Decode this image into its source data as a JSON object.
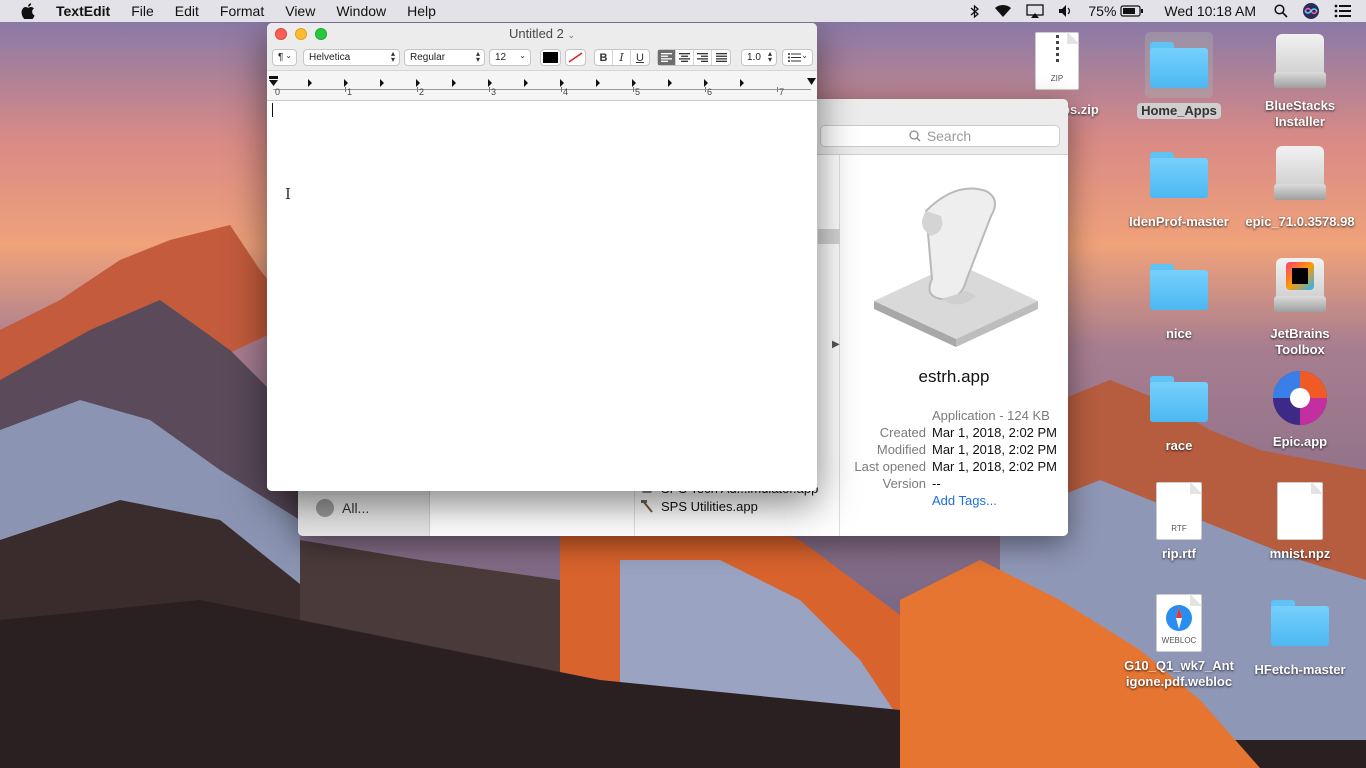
{
  "menubar": {
    "app_name": "TextEdit",
    "menus": [
      "File",
      "Edit",
      "Format",
      "View",
      "Window",
      "Help"
    ],
    "battery": "75%",
    "clock": "Wed 10:18 AM",
    "icons": [
      "apple-icon",
      "bluetooth-icon",
      "wifi-icon",
      "airplay-icon",
      "volume-icon",
      "battery-icon",
      "spotlight-icon",
      "siri-icon",
      "notification-center-icon"
    ]
  },
  "textedit": {
    "title": "Untitled 2",
    "paragraph_style": "¶",
    "font_family": "Helvetica",
    "font_style": "Regular",
    "font_size": "12",
    "bold": "B",
    "italic": "I",
    "underline": "U",
    "line_spacing": "1.0",
    "ruler_numbers": [
      "0",
      "1",
      "2",
      "3",
      "4",
      "5",
      "6",
      "7"
    ],
    "text_color": "#000000"
  },
  "finder": {
    "search_placeholder": "Search",
    "sidebar_all": "All...",
    "files": [
      "SPS Tech Ad...imulator.app",
      "SPS Utilities.app"
    ],
    "preview": {
      "name": "estrh.app",
      "kind": "Application - 124 KB",
      "created_label": "Created",
      "created": "Mar 1, 2018, 2:02 PM",
      "modified_label": "Modified",
      "modified": "Mar 1, 2018, 2:02 PM",
      "last_opened_label": "Last opened",
      "last_opened": "Mar 1, 2018, 2:02 PM",
      "version_label": "Version",
      "version": "--",
      "add_tags": "Add Tags..."
    }
  },
  "desktop": {
    "icons": [
      {
        "label": "ps.zip",
        "type": "zip"
      },
      {
        "label": "Home_Apps",
        "type": "folder"
      },
      {
        "label": "BlueStacks Installer",
        "type": "drive"
      },
      {
        "label": "IdenProf-master",
        "type": "folder"
      },
      {
        "label": "epic_71.0.3578.98",
        "type": "drive"
      },
      {
        "label": "nice",
        "type": "folder"
      },
      {
        "label": "JetBrains Toolbox",
        "type": "drive"
      },
      {
        "label": "race",
        "type": "folder"
      },
      {
        "label": "Epic.app",
        "type": "app"
      },
      {
        "label": "rip.rtf",
        "type": "doc",
        "tag": "RTF"
      },
      {
        "label": "mnist.npz",
        "type": "doc",
        "tag": ""
      },
      {
        "label": "G10_Q1_wk7_Antigone.pdf.webloc",
        "type": "webloc",
        "tag": "WEBLOC"
      },
      {
        "label": "HFetch-master",
        "type": "folder"
      }
    ]
  },
  "colors": {
    "close": "#fd5f57",
    "minimize": "#febb2e",
    "zoom": "#28c840",
    "folder": "#5fc4f5",
    "link": "#1e6fe0"
  }
}
